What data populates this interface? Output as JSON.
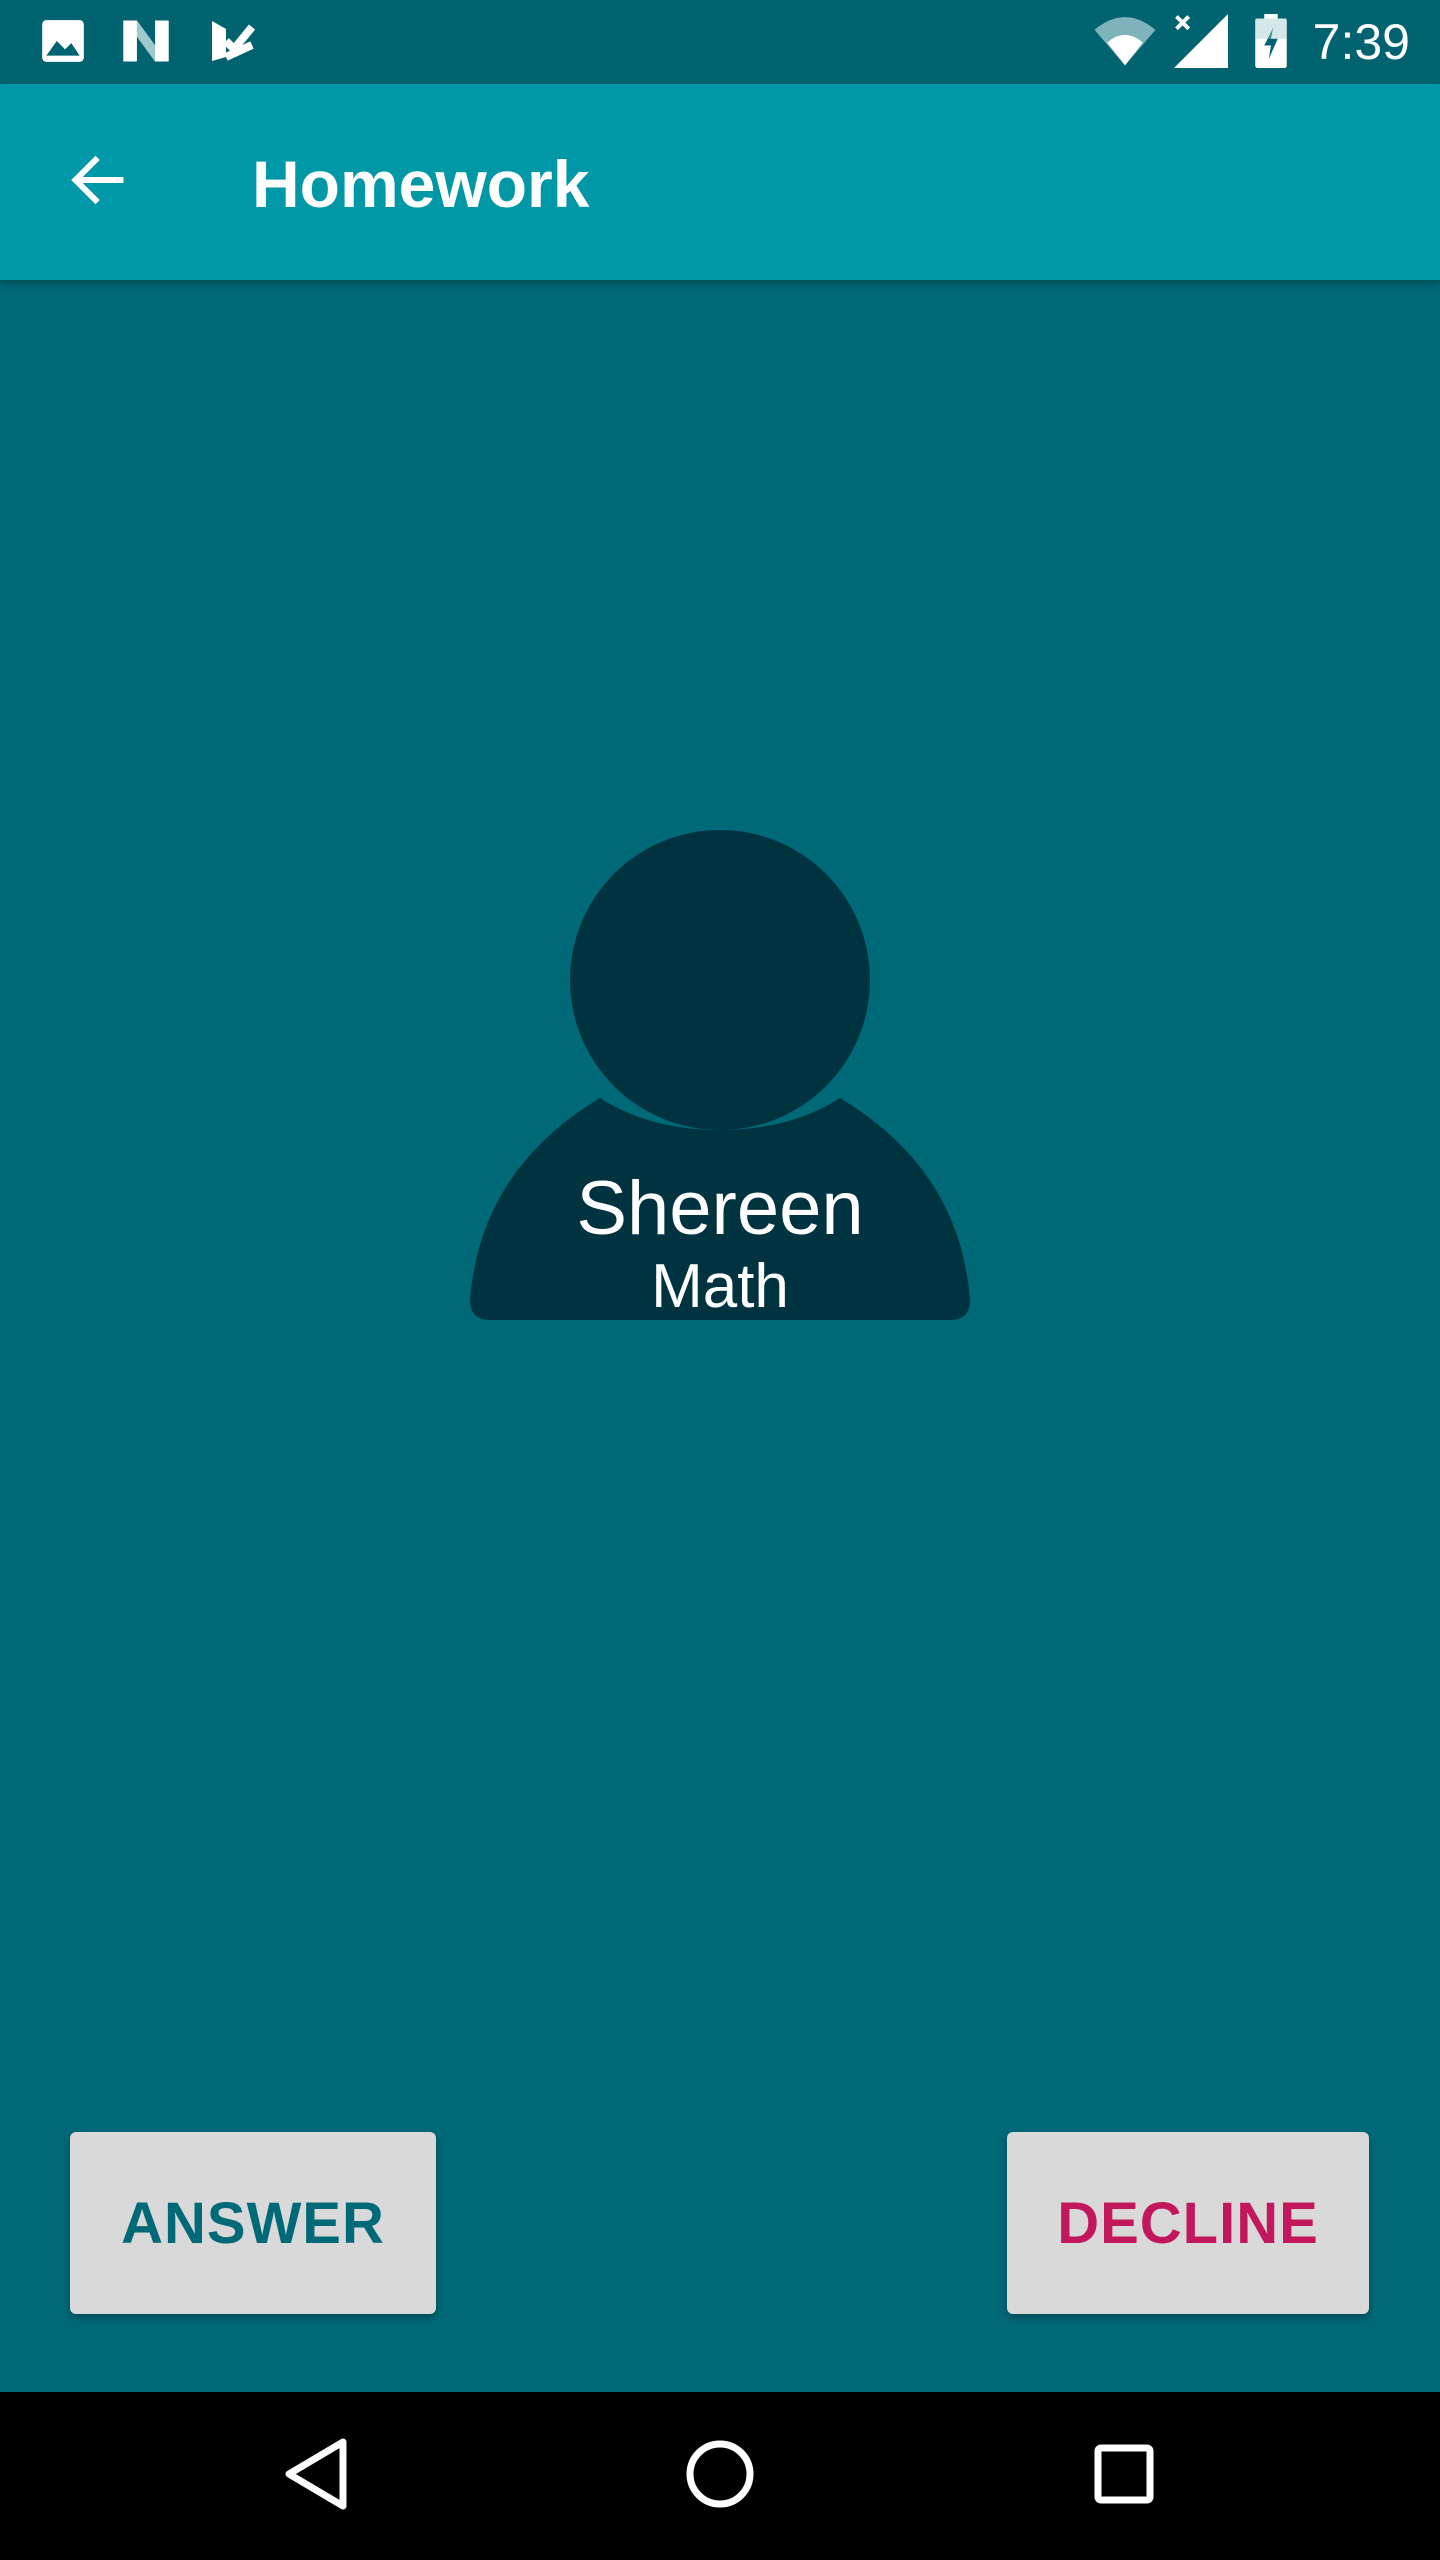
{
  "status_bar": {
    "time": "7:39",
    "left_icons": [
      "image-icon",
      "n-app-icon",
      "checkmark-app-icon"
    ],
    "right_icons": [
      "wifi-icon",
      "cell-signal-icon",
      "battery-charging-icon"
    ]
  },
  "app_bar": {
    "title": "Homework",
    "back_icon": "arrow-back-icon"
  },
  "call": {
    "caller_name": "Shereen",
    "subject": "Math",
    "avatar_icon": "person-icon"
  },
  "actions": {
    "answer_label": "ANSWER",
    "decline_label": "DECLINE"
  },
  "nav_bar": {
    "icons": [
      "nav-back-icon",
      "nav-home-icon",
      "nav-recents-icon"
    ]
  },
  "colors": {
    "status_bar": "#00636f",
    "app_bar": "#0097a7",
    "background": "#006978",
    "avatar": "#003340",
    "button_bg": "#d9d9d9",
    "answer_text": "#006978",
    "decline_text": "#c2185b"
  }
}
